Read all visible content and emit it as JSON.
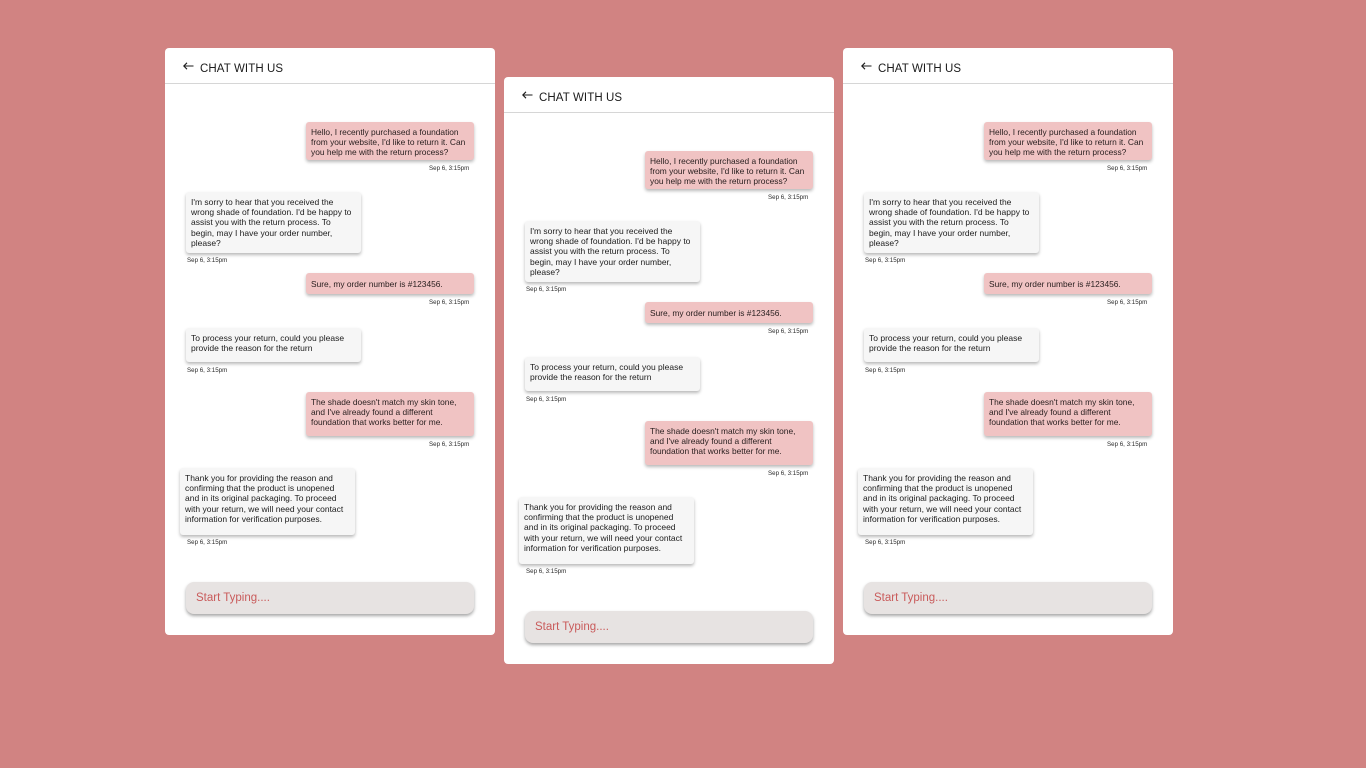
{
  "header": {
    "title": "CHAT WITH US",
    "back_icon": "arrow-left-icon"
  },
  "messages": [
    {
      "sender": "user",
      "text": "Hello, I recently purchased a foundation from your website, I'd like to return it. Can you help me with the return process?",
      "time": "Sep 6, 3:15pm"
    },
    {
      "sender": "agent",
      "text": "I'm sorry to hear that you received the wrong shade of foundation. I'd be happy to assist you with the return process. To begin, may I have your order number, please?",
      "time": "Sep 6, 3:15pm"
    },
    {
      "sender": "user",
      "text": "Sure, my order number is #123456.",
      "time": "Sep 6, 3:15pm"
    },
    {
      "sender": "agent",
      "text": "To process your return, could you please provide the reason for the return",
      "time": "Sep 6, 3:15pm"
    },
    {
      "sender": "user",
      "text": "The shade doesn't match my skin tone, and I've already found a different foundation that works better for me.",
      "time": "Sep 6, 3:15pm"
    },
    {
      "sender": "agent",
      "text": "Thank you for providing the reason and confirming that the product is unopened and in its original packaging. To proceed with your return, we will need your contact information for verification purposes.",
      "time": "Sep 6, 3:15pm"
    }
  ],
  "input": {
    "placeholder": "Start Typing...."
  },
  "colors": {
    "background": "#d18382",
    "user_bubble": "#f0c3c3",
    "agent_bubble": "#f6f6f6",
    "input_bg": "#e7e3e2",
    "placeholder_text": "#c95b5b"
  }
}
